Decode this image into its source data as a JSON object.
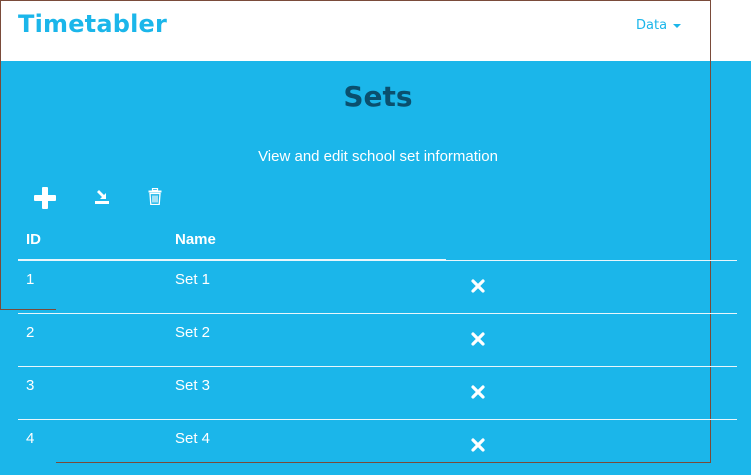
{
  "app": {
    "title": "Timetabler",
    "brand_color": "#1bb6ea"
  },
  "nav": {
    "data_label": "Data",
    "data_icon": "caret-down-icon"
  },
  "page": {
    "title": "Sets",
    "subtitle": "View and edit school set information",
    "background": "#1bb6ea",
    "title_color": "#0a4f6e"
  },
  "toolbar": {
    "add_icon": "plus-icon",
    "import_icon": "import-icon",
    "delete_icon": "trash-icon"
  },
  "table": {
    "headers": {
      "id": "ID",
      "name": "Name"
    },
    "rows": [
      {
        "id": "1",
        "name": "Set 1",
        "action_icon": "remove-icon"
      },
      {
        "id": "2",
        "name": "Set 2",
        "action_icon": "remove-icon"
      },
      {
        "id": "3",
        "name": "Set 3",
        "action_icon": "remove-icon"
      },
      {
        "id": "4",
        "name": "Set 4",
        "action_icon": "remove-icon"
      }
    ]
  }
}
